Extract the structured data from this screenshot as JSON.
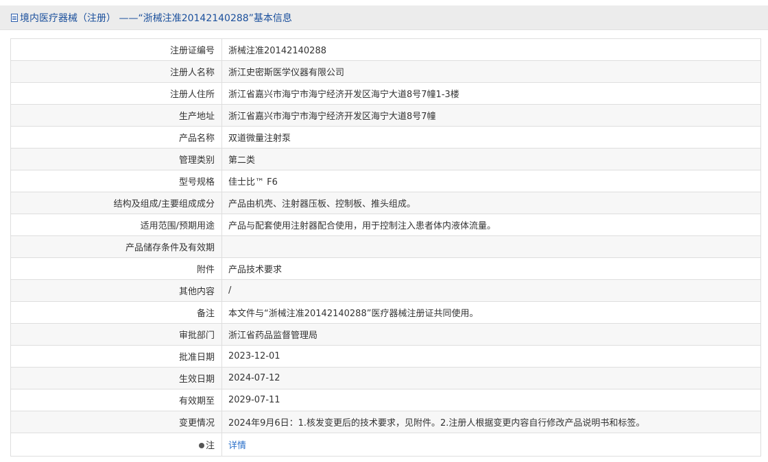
{
  "header": {
    "title": "境内医疗器械（注册） ——“浙械注准20142140288”基本信息",
    "icon": "document-icon"
  },
  "rows": [
    {
      "label": "注册证编号",
      "value": "浙械注准20142140288"
    },
    {
      "label": "注册人名称",
      "value": "浙江史密斯医学仪器有限公司"
    },
    {
      "label": "注册人住所",
      "value": "浙江省嘉兴市海宁市海宁经济开发区海宁大道8号7幢1-3楼"
    },
    {
      "label": "生产地址",
      "value": "浙江省嘉兴市海宁市海宁经济开发区海宁大道8号7幢"
    },
    {
      "label": "产品名称",
      "value": "双道微量注射泵"
    },
    {
      "label": "管理类别",
      "value": "第二类"
    },
    {
      "label": "型号规格",
      "value": "佳士比™ F6"
    },
    {
      "label": "结构及组成/主要组成成分",
      "value": "产品由机壳、注射器压板、控制板、推头组成。"
    },
    {
      "label": "适用范围/预期用途",
      "value": "产品与配套使用注射器配合使用，用于控制注入患者体内液体流量。"
    },
    {
      "label": "产品储存条件及有效期",
      "value": ""
    },
    {
      "label": "附件",
      "value": "产品技术要求"
    },
    {
      "label": "其他内容",
      "value": "/"
    },
    {
      "label": "备注",
      "value": "本文件与“浙械注准20142140288”医疗器械注册证共同使用。"
    },
    {
      "label": "审批部门",
      "value": "浙江省药品监督管理局"
    },
    {
      "label": "批准日期",
      "value": "2023-12-01"
    },
    {
      "label": "生效日期",
      "value": "2024-07-12"
    },
    {
      "label": "有效期至",
      "value": "2029-07-11"
    },
    {
      "label": "变更情况",
      "value": "2024年9月6日：1.核发变更后的技术要求，见附件。2.注册人根据变更内容自行修改产品说明书和标签。"
    }
  ],
  "note_row": {
    "label": "注",
    "icon": "note-icon",
    "link_text": "详情"
  },
  "colors": {
    "title_text": "#1a4f9c",
    "title_bar_bg": "#ececec",
    "link": "#2a6fc9",
    "border": "#dedede",
    "alt_row_bg": "#f7f7f7"
  }
}
